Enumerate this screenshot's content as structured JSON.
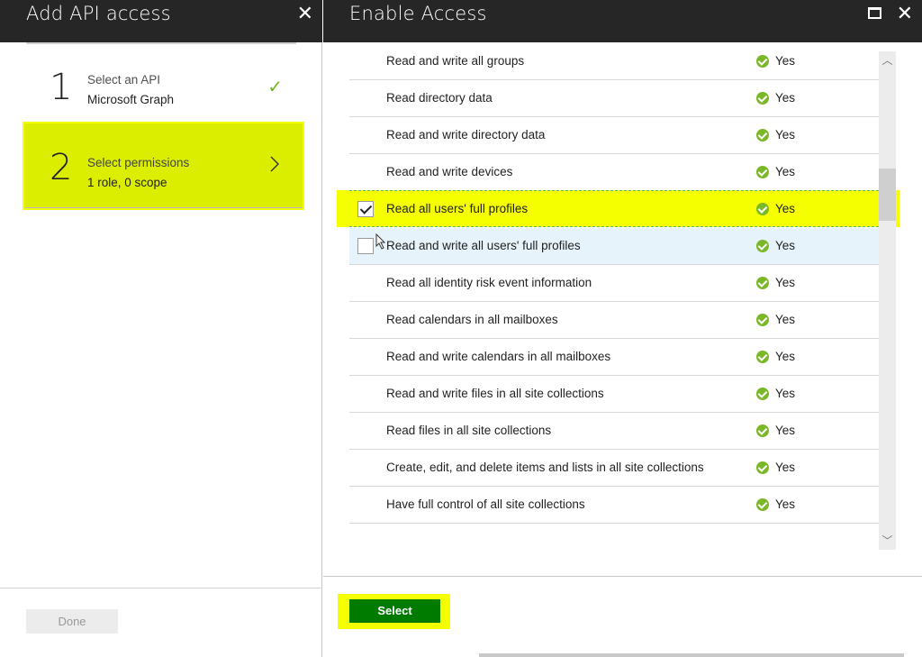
{
  "left_blade": {
    "title": "Add API access",
    "close_glyph": "✕",
    "steps": [
      {
        "number": "1",
        "label": "Select an API",
        "value": "Microsoft Graph",
        "status": "complete"
      },
      {
        "number": "2",
        "label": "Select permissions",
        "value": "1 role, 0 scope",
        "status": "active"
      }
    ],
    "check_glyph": "✓",
    "done_label": "Done"
  },
  "right_blade": {
    "title": "Enable Access",
    "close_glyph": "✕",
    "permissions": [
      {
        "label": "Read and write all groups",
        "status": "Yes"
      },
      {
        "label": "Read directory data",
        "status": "Yes"
      },
      {
        "label": "Read and write directory data",
        "status": "Yes"
      },
      {
        "label": "Read and write devices",
        "status": "Yes"
      },
      {
        "label": "Read all users' full profiles",
        "status": "Yes",
        "checked": true
      },
      {
        "label": "Read and write all users' full profiles",
        "status": "Yes",
        "checked": false
      },
      {
        "label": "Read all identity risk event information",
        "status": "Yes"
      },
      {
        "label": "Read calendars in all mailboxes",
        "status": "Yes"
      },
      {
        "label": "Read and write calendars in all mailboxes",
        "status": "Yes"
      },
      {
        "label": "Read and write files in all site collections",
        "status": "Yes"
      },
      {
        "label": "Read files in all site collections",
        "status": "Yes"
      },
      {
        "label": "Create, edit, and delete items and lists in all site collections",
        "status": "Yes"
      },
      {
        "label": "Have full control of all site collections",
        "status": "Yes"
      }
    ],
    "select_label": "Select",
    "scroll_up_glyph": "︿",
    "scroll_down_glyph": "﹀"
  },
  "colors": {
    "header_bg": "#262626",
    "highlight": "#f5ff00",
    "step_active": "#dcee00",
    "check_green": "#7ab829",
    "select_green": "#007b00"
  }
}
